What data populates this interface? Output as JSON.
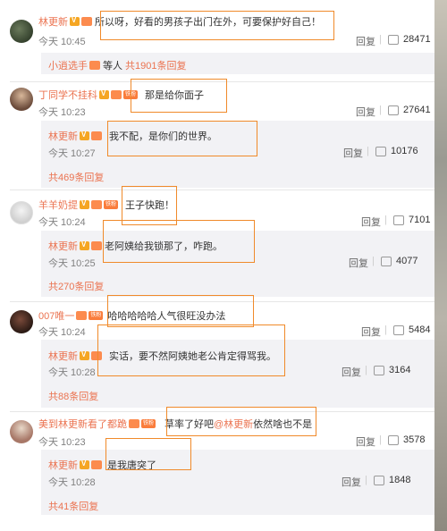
{
  "comments": [
    {
      "author": "林更新",
      "text": "所以呀，好看的男孩子出门在外，可要保护好自己！",
      "time": "今天 10:45",
      "reply": "回复",
      "likes": "28471",
      "sub_summary": {
        "author": "小逍选手",
        "middle": "等人",
        "count": "共1901条回复"
      }
    },
    {
      "author": "丁同学不挂科",
      "text": "那是给你面子",
      "time": "今天 10:23",
      "reply": "回复",
      "likes": "27641",
      "sub": {
        "author": "林更新",
        "text": "我不配，是你们的世界。",
        "time": "今天 10:27",
        "reply": "回复",
        "likes": "10176"
      },
      "more": "共469条回复"
    },
    {
      "author": "羊羊奶提",
      "text": "王子快跑！",
      "time": "今天 10:24",
      "reply": "回复",
      "likes": "7101",
      "sub": {
        "author": "林更新",
        "text": "老阿姨给我锁那了，咋跑。",
        "time": "今天 10:25",
        "reply": "回复",
        "likes": "4077"
      },
      "more": "共270条回复"
    },
    {
      "author": "007唯一",
      "text": "哈哈哈哈哈人气很旺没办法",
      "time": "今天 10:24",
      "reply": "回复",
      "likes": "5484",
      "sub": {
        "author": "林更新",
        "text": "实话，要不然阿姨她老公肯定得骂我。",
        "time": "今天 10:28",
        "reply": "回复",
        "likes": "3164"
      },
      "more": "共88条回复"
    },
    {
      "author": "美到林更新看了都跪",
      "text_pre": "草率了好吧",
      "mention": "@林更新",
      "text_post": " 依然啥也不是",
      "time": "今天 10:23",
      "reply": "回复",
      "likes": "3578",
      "sub": {
        "author": "林更新",
        "text": "是我唐突了",
        "time": "今天 10:28",
        "reply": "回复",
        "likes": "1848"
      },
      "more": "共41条回复"
    }
  ],
  "icons": {
    "thumb": "thumbs-up-icon",
    "vip": "verified-v-icon"
  },
  "colors": {
    "accent": "#eb7350",
    "highlight": "#f08a2a",
    "subbg": "#f2f2f5"
  }
}
